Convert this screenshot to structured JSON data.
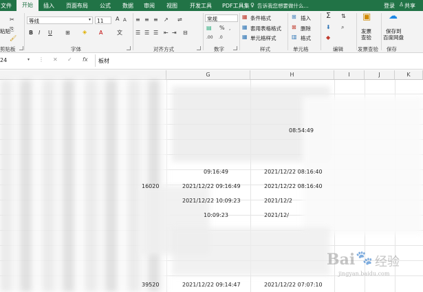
{
  "ribbon_tabs": [
    "文件",
    "开始",
    "插入",
    "页面布局",
    "公式",
    "数据",
    "审阅",
    "视图",
    "开发工具",
    "PDF工具集"
  ],
  "tell_me": "告诉我您想要做什么...",
  "login": "登录",
  "share": "共享",
  "clipboard": {
    "paste": "粘贴",
    "group": "剪贴板"
  },
  "font": {
    "name": "等线",
    "size": "11",
    "bold": "B",
    "italic": "I",
    "underline": "U",
    "group": "字体"
  },
  "align": {
    "group": "对齐方式"
  },
  "number": {
    "format": "常规",
    "group": "数字",
    "percent": "%"
  },
  "styles": {
    "cond": "条件格式",
    "table": "套用表格格式",
    "cell": "单元格样式",
    "group": "样式"
  },
  "cells": {
    "insert": "插入",
    "delete": "删除",
    "format": "格式",
    "group": "单元格"
  },
  "editing": {
    "group": "编辑"
  },
  "invoice": {
    "label1": "发票",
    "label2": "查验",
    "group": "发票查验"
  },
  "save": {
    "label1": "保存到",
    "label2": "百度网盘",
    "group": "保存"
  },
  "formula_bar": {
    "name_box": "24",
    "content": "板材"
  },
  "columns": [
    "G",
    "H",
    "I",
    "J",
    "K"
  ],
  "rows": [
    {
      "g": "",
      "h": "08:54:49"
    },
    {
      "g": "09:16:49",
      "h": "2021/12/22 08:16:40"
    },
    {
      "pre": "16020",
      "g": "2021/12/22 09:16:49",
      "h": "2021/12/22 08:16:40"
    },
    {
      "g": "2021/12/22 10:09:23",
      "h": "2021/12/2"
    },
    {
      "g": "10:09:23",
      "h": "2021/12/"
    },
    {
      "pre": "39520",
      "g": "2021/12/22 09:14:47",
      "h": "2021/12/22 07:07:10"
    }
  ],
  "watermark": {
    "brand": "Bai",
    "brand2": "经验",
    "sub": "jingyan.baidu.com"
  }
}
